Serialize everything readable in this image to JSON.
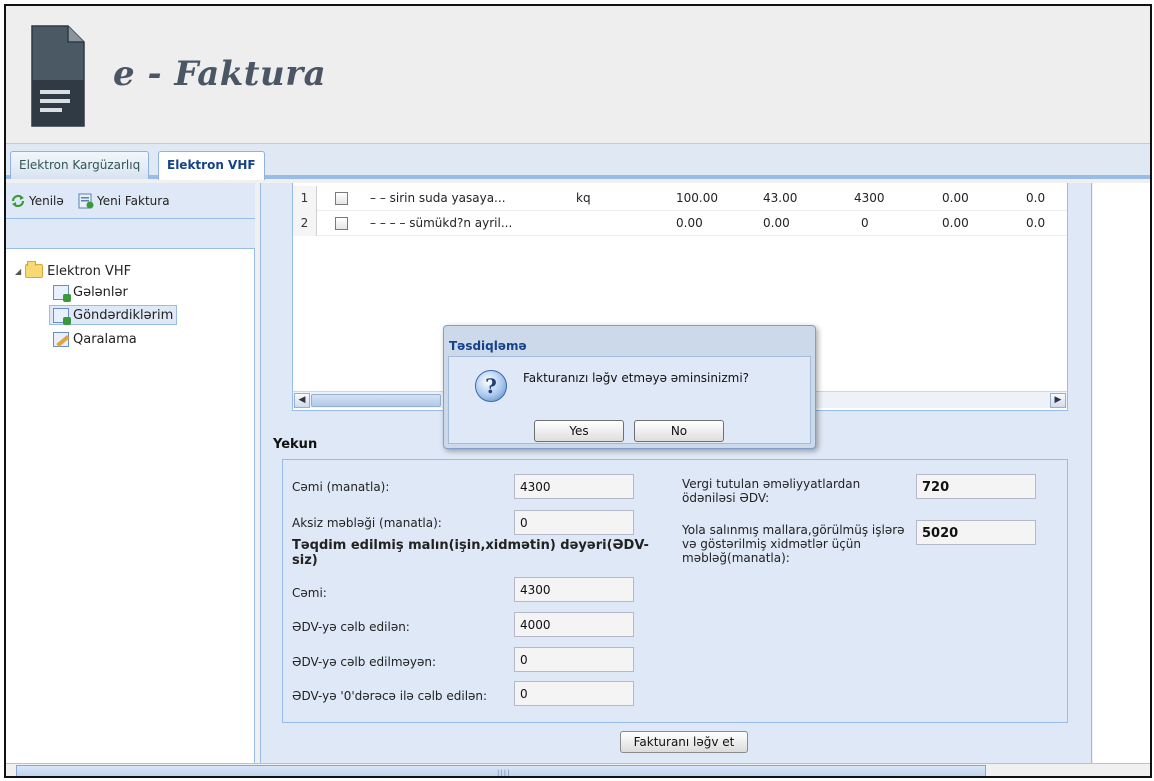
{
  "app": {
    "title": "e - Faktura"
  },
  "tabs": [
    {
      "label": "Elektron Kargüzarlıq",
      "active": false
    },
    {
      "label": "Elektron VHF",
      "active": true
    }
  ],
  "toolbar": {
    "refresh_label": "Yenilə",
    "new_invoice_label": "Yeni Faktura"
  },
  "tree": {
    "root": "Elektron VHF",
    "items": [
      {
        "label": "Gələnlər",
        "icon": "inbox-doc-icon"
      },
      {
        "label": "Göndərdiklərim",
        "icon": "sent-doc-icon",
        "selected": true
      },
      {
        "label": "Qaralama",
        "icon": "draft-pencil-icon"
      }
    ]
  },
  "grid": {
    "rows": [
      {
        "num": "1",
        "name": "– – sirin suda yasaya...",
        "unit": "kq",
        "qty": "100.00",
        "price": "43.00",
        "total": "4300",
        "c7": "0.00",
        "c8": "0.0"
      },
      {
        "num": "2",
        "name": "– – – – sümükd?n ayril...",
        "unit": "",
        "qty": "0.00",
        "price": "0.00",
        "total": "0",
        "c7": "0.00",
        "c8": "0.0"
      }
    ]
  },
  "summary": {
    "title": "Yekun",
    "total_label": "Cəmi (manatla):",
    "total_value": "4300",
    "excise_label": "Aksiz məbləği (manatla):",
    "excise_value": "0",
    "goods_heading": "Təqdim edilmiş malın(işin,xidmətin) dəyəri(ƏDV-siz)",
    "sum_label": "Cəmi:",
    "sum_value": "4300",
    "vat_label": "ƏDV-yə cəlb edilən:",
    "vat_value": "4000",
    "novat_label": "ƏDV-yə cəlb edilməyən:",
    "novat_value": "0",
    "zero_label": "ƏDV-yə '0'dərəcə ilə cəlb edilən:",
    "zero_value": "0",
    "vat_paid_label": "Vergi tutulan əməliyyatlardan ödəniləsi ƏDV:",
    "vat_paid_value": "720",
    "shipped_label": "Yola salınmış mallara,görülmüş işlərə və göstərilmiş xidmətlər üçün məbləğ(manatla):",
    "shipped_value": "5020"
  },
  "actions": {
    "cancel_invoice": "Fakturanı ləğv et"
  },
  "dialog": {
    "title": "Təsdiqləmə",
    "message": "Fakturanızı ləğv etməyə əminsinizmi?",
    "yes": "Yes",
    "no": "No"
  },
  "colors": {
    "accent": "#15428b",
    "panel": "#dfe8f6",
    "border": "#99bbe8"
  }
}
